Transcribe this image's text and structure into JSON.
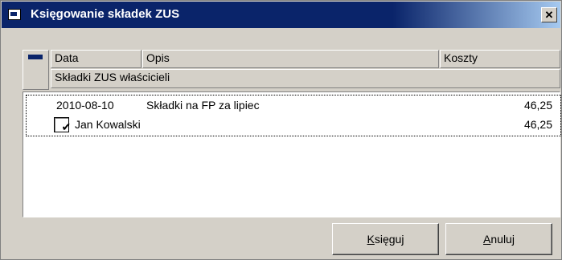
{
  "window": {
    "title": "Księgowanie składek ZUS",
    "close_label": "✕"
  },
  "header": {
    "col_data": "Data",
    "col_opis": "Opis",
    "col_koszty": "Koszty",
    "group_label": "Składki ZUS właścicieli"
  },
  "list": {
    "rows": [
      {
        "date": "2010-08-10",
        "description": "Składki na FP za lipiec",
        "amount": "46,25"
      }
    ],
    "sub": {
      "checked": true,
      "name": "Jan Kowalski",
      "amount": "46,25"
    }
  },
  "buttons": {
    "post_accel": "K",
    "post_rest": "sięguj",
    "cancel_accel": "A",
    "cancel_rest": "nuluj"
  }
}
